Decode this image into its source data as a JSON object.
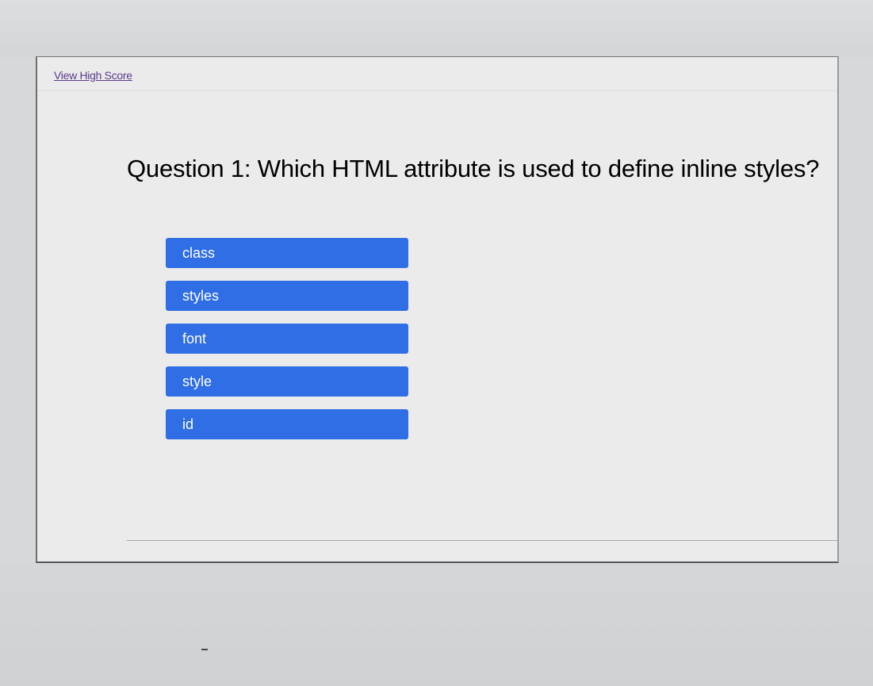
{
  "header": {
    "high_score_link": "View High Score"
  },
  "quiz": {
    "question": "Question 1: Which HTML attribute is used to define inline styles?",
    "answers": [
      {
        "label": "class"
      },
      {
        "label": "styles"
      },
      {
        "label": "font"
      },
      {
        "label": "style"
      },
      {
        "label": "id"
      }
    ]
  },
  "colors": {
    "answer_button": "#2f6ee4",
    "link": "#5a3a8c",
    "screen_background": "#ebebeb"
  }
}
